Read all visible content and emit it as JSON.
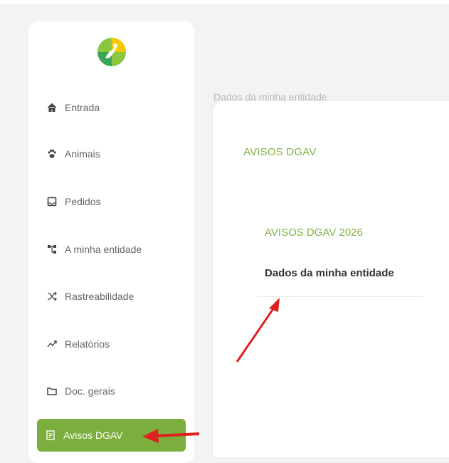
{
  "sidebar": {
    "items": [
      {
        "label": "Entrada",
        "icon": "home-icon"
      },
      {
        "label": "Animais",
        "icon": "paw-icon"
      },
      {
        "label": "Pedidos",
        "icon": "inbox-icon"
      },
      {
        "label": "A minha entidade",
        "icon": "sitemap-icon"
      },
      {
        "label": "Rastreabilidade",
        "icon": "shuffle-icon"
      },
      {
        "label": "Relatórios",
        "icon": "chart-line-icon"
      },
      {
        "label": "Doc. gerais",
        "icon": "folder-icon"
      },
      {
        "label": "Avisos DGAV",
        "icon": "notice-icon",
        "active": true
      }
    ],
    "accent_color": "#7cae3d"
  },
  "main": {
    "background_heading": "Dados da minha entidade",
    "card_title": "AVISOS DGAV",
    "section_title": "AVISOS DGAV 2026",
    "link": "Dados da minha entidade"
  },
  "annotations": {
    "arrow_color": "#e0201f"
  }
}
